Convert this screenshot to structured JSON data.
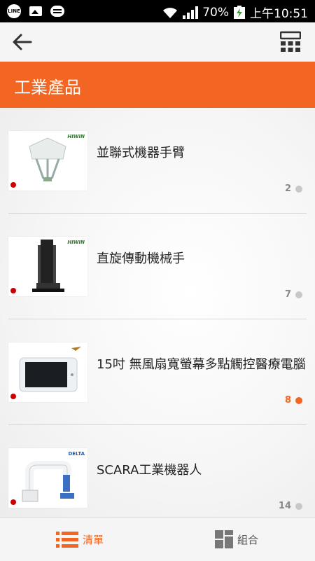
{
  "status_bar": {
    "app_badge": "LINE",
    "battery_percent": "70%",
    "time": "上午10:51"
  },
  "header": {
    "title": "工業產品"
  },
  "products": [
    {
      "name": "並聯式機器手臂",
      "count": "2",
      "highlighted": false,
      "brand": "HIWIN"
    },
    {
      "name": "直旋傳動機械手",
      "count": "7",
      "highlighted": false,
      "brand": "HIWIN"
    },
    {
      "name": "15吋 無風扇寬螢幕多點觸控醫療電腦",
      "count": "8",
      "highlighted": true,
      "brand": ""
    },
    {
      "name": "SCARA工業機器人",
      "count": "14",
      "highlighted": false,
      "brand": "DELTA"
    }
  ],
  "bottom_nav": {
    "list_label": "清單",
    "grid_label": "組合"
  },
  "colors": {
    "accent": "#f26522",
    "inactive_dot": "#c8c8c8"
  }
}
